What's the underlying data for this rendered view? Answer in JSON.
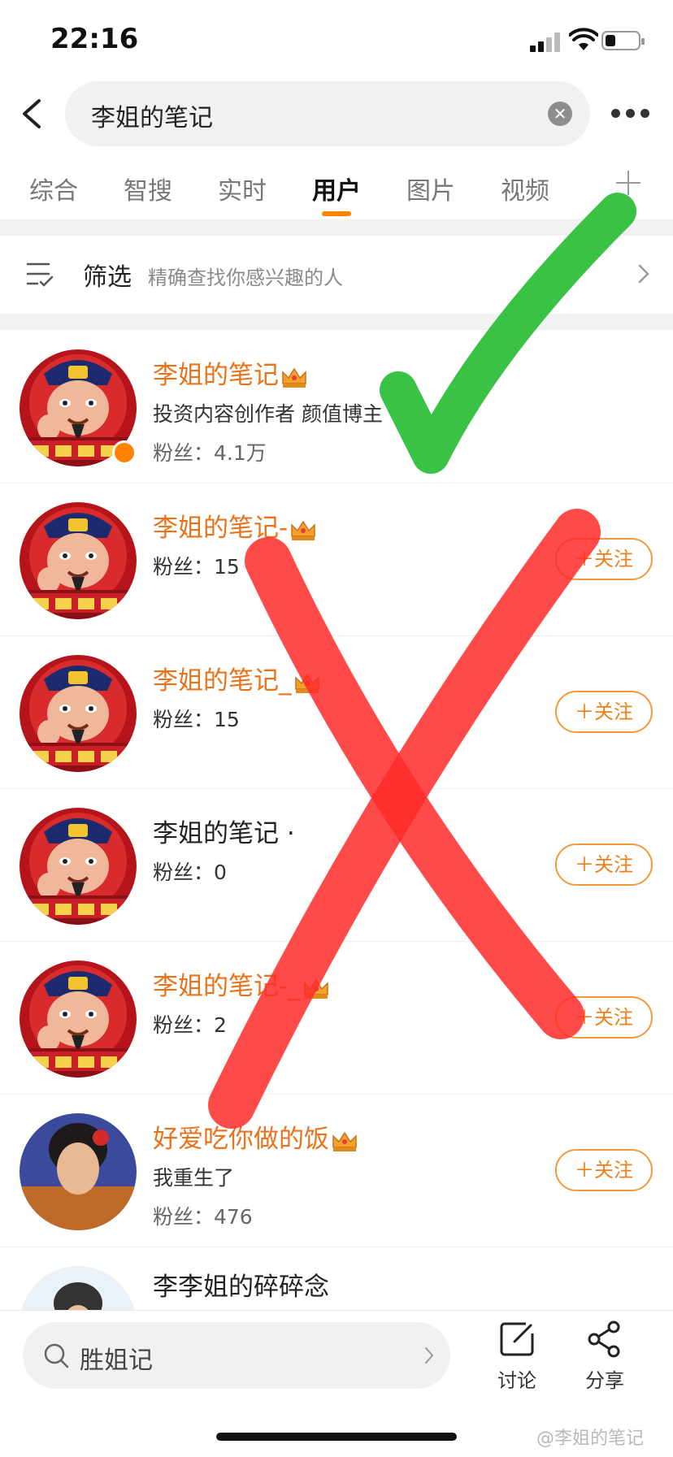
{
  "status": {
    "time": "22:16"
  },
  "search": {
    "query": "李姐的笔记"
  },
  "tabs": [
    {
      "label": "综合"
    },
    {
      "label": "智搜"
    },
    {
      "label": "实时"
    },
    {
      "label": "用户",
      "active": true
    },
    {
      "label": "图片"
    },
    {
      "label": "视频"
    }
  ],
  "filter": {
    "label": "筛选",
    "desc": "精确查找你感兴趣的人"
  },
  "users": [
    {
      "name": "李姐的笔记",
      "name_color": "#e8731a",
      "crown": true,
      "desc": "投资内容创作者 颜值博主",
      "fans": "粉丝：4.1万",
      "verified": true,
      "follow": ""
    },
    {
      "name": "李姐的笔记-",
      "name_color": "#e8731a",
      "crown": true,
      "desc": "",
      "fans": "粉丝：15",
      "follow": "＋关注"
    },
    {
      "name": "李姐的笔记_",
      "name_color": "#e8731a",
      "crown": true,
      "desc": "",
      "fans": "粉丝：15",
      "follow": "＋关注"
    },
    {
      "name": "李姐的笔记 ·",
      "name_color": "#222222",
      "crown": false,
      "desc": "",
      "fans": "粉丝：0",
      "follow": "＋关注"
    },
    {
      "name": "李姐的笔记-_",
      "name_color": "#e8731a",
      "crown": true,
      "desc": "",
      "fans": "粉丝：2",
      "follow": "＋关注"
    },
    {
      "name": "好爱吃你做的饭",
      "name_color": "#e8731a",
      "crown": true,
      "desc": "我重生了",
      "fans": "粉丝：476",
      "follow": "＋关注"
    },
    {
      "name": "李李姐的碎碎念",
      "name_color": "#222222",
      "crown": false,
      "desc": "",
      "fans": "",
      "follow": ""
    }
  ],
  "bottom": {
    "search_text": "胜姐记",
    "discuss_label": "讨论",
    "share_label": "分享"
  },
  "watermark": "@李姐的笔记",
  "colors": {
    "accent": "#ff8200",
    "check": "#2fbf3a",
    "cross": "#ff2a2a"
  }
}
